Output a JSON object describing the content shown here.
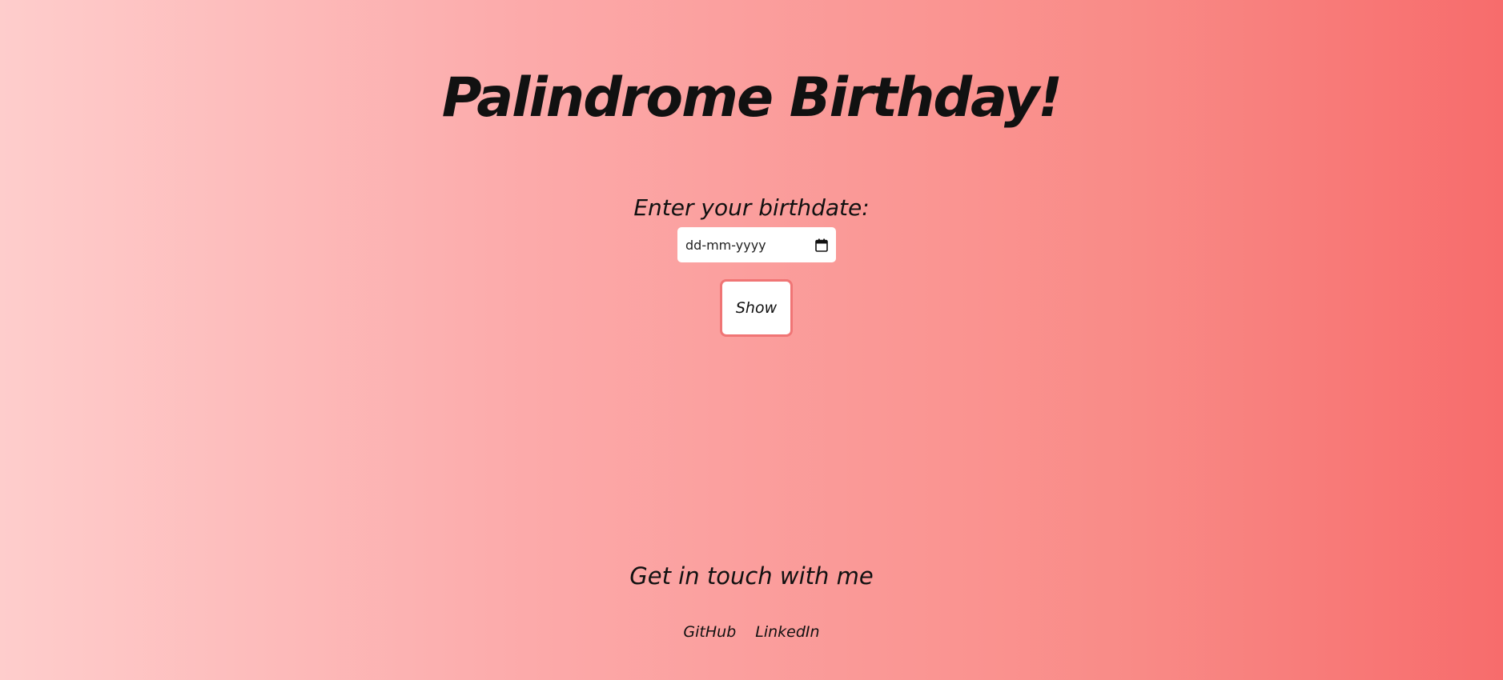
{
  "header": {
    "title": "Palindrome Birthday!"
  },
  "form": {
    "label": "Enter your birthdate:",
    "date_placeholder": "dd-mm-yyyy",
    "calendar_icon": "calendar-icon",
    "show_label": "Show",
    "button_border_color": "#f07575"
  },
  "footer": {
    "heading": "Get in touch with me",
    "links": [
      {
        "label": "GitHub"
      },
      {
        "label": "LinkedIn"
      }
    ]
  },
  "colors": {
    "gradient_start": "#fecdcc",
    "gradient_end": "#f76c6c"
  }
}
